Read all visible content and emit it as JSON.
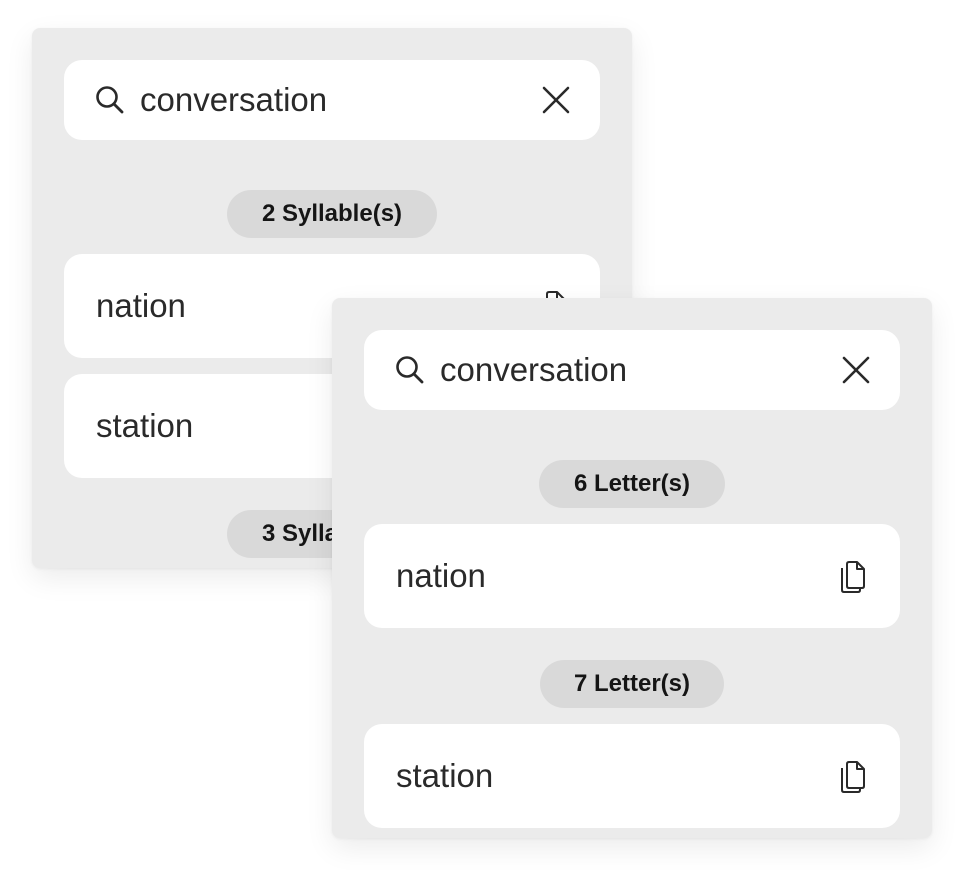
{
  "back_window": {
    "search": {
      "query": "conversation",
      "search_icon": "search-icon",
      "clear_icon": "close-icon"
    },
    "groups": [
      {
        "label": "2 Syllable(s)",
        "results": [
          "nation",
          "station"
        ]
      },
      {
        "label": "3 Syllable(s)",
        "results": []
      }
    ]
  },
  "front_window": {
    "search": {
      "query": "conversation",
      "search_icon": "search-icon",
      "clear_icon": "close-icon"
    },
    "groups": [
      {
        "label": "6 Letter(s)",
        "results": [
          "nation"
        ]
      },
      {
        "label": "7 Letter(s)",
        "results": [
          "station"
        ]
      }
    ],
    "copy_icon": "copy-icon"
  },
  "colors": {
    "page_background": "#ffffff",
    "panel_background": "#ebebeb",
    "card_background": "#ffffff",
    "pill_background": "#d9d9d9",
    "text": "#2a2a2a"
  }
}
